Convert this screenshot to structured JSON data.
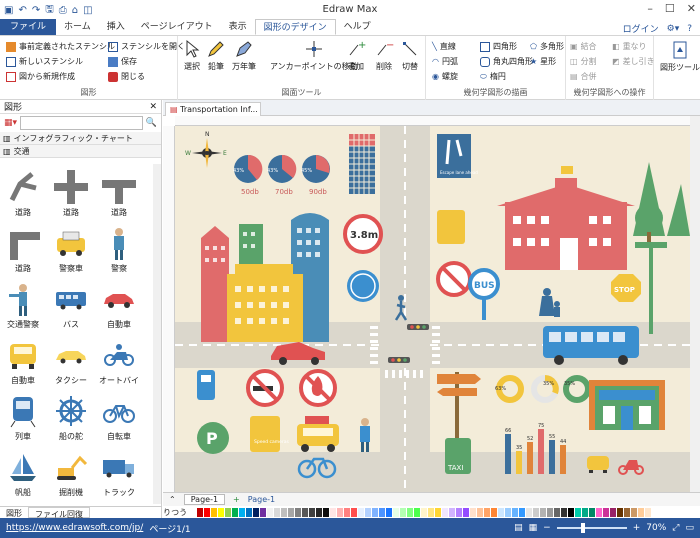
{
  "app": {
    "title": "Edraw Max"
  },
  "quick_access": [
    "▣",
    "↶",
    "↷",
    "🖫",
    "⎙",
    "⌂",
    "◫"
  ],
  "menu": {
    "file": "ファイル",
    "items": [
      "ホーム",
      "挿入",
      "ページレイアウト",
      "表示",
      "図形のデザイン",
      "ヘルプ"
    ],
    "active_index": 4
  },
  "account": {
    "login": "ログイン"
  },
  "ribbon": {
    "library": {
      "items": [
        "事前定義されたステンシル",
        "ステンシルを開く",
        "新しいステンシル",
        "保存",
        "図から新規作成",
        "閉じる"
      ],
      "group": "図形"
    },
    "tools": {
      "items": [
        "選択",
        "鉛筆",
        "万年筆",
        "アンカーポイントの移動",
        "追加",
        "削除",
        "切替"
      ],
      "group": "図面ツール"
    },
    "geometry": {
      "items": [
        "直線",
        "四角形",
        "多角形",
        "円弧",
        "角丸四角形",
        "星形",
        "螺旋",
        "楕円"
      ],
      "group": "幾何学図形の描画"
    },
    "operations": {
      "items": [
        "結合",
        "重なり",
        "分割",
        "差し引き",
        "合併"
      ],
      "group": "幾何学図形への操作"
    },
    "shape_tools": {
      "label": "図形ツール"
    }
  },
  "left_panel": {
    "title": "図形",
    "search_placeholder": "",
    "categories": [
      "インフォグラフィック・チャート",
      "交通"
    ],
    "shapes": [
      "道路",
      "道路",
      "道路",
      "道路",
      "警察車",
      "警察",
      "交通警察",
      "バス",
      "自動車",
      "自動車",
      "タクシー",
      "オートバイ",
      "列車",
      "船の舵",
      "自転車",
      "帆船",
      "掘削機",
      "トラック"
    ],
    "bottom_tabs": [
      "図形",
      "ファイル回復"
    ]
  },
  "document": {
    "tab": "Transportation Inf...",
    "page_tab": "Page-1",
    "page_current": "Page-1",
    "color_label": "りつう"
  },
  "canvas": {
    "pie_labels": [
      "50db",
      "70db",
      "90db"
    ],
    "pie_values": [
      "43%",
      "43%",
      "45%"
    ],
    "sign_text": "3.8m",
    "bus_sign": "BUS",
    "stop_sign": "STOP",
    "taxi_sign": "TAXI",
    "speed_label": "Speed cameras",
    "escape_label": "Escape lane ahead",
    "donut_labels": [
      "63%",
      "35%",
      "35%"
    ],
    "bar_values": [
      "66",
      "35",
      "52",
      "75",
      "55",
      "44"
    ]
  },
  "status": {
    "url": "https://www.edrawsoft.com/jp/",
    "page": "ページ1/1",
    "zoom": "70%"
  }
}
